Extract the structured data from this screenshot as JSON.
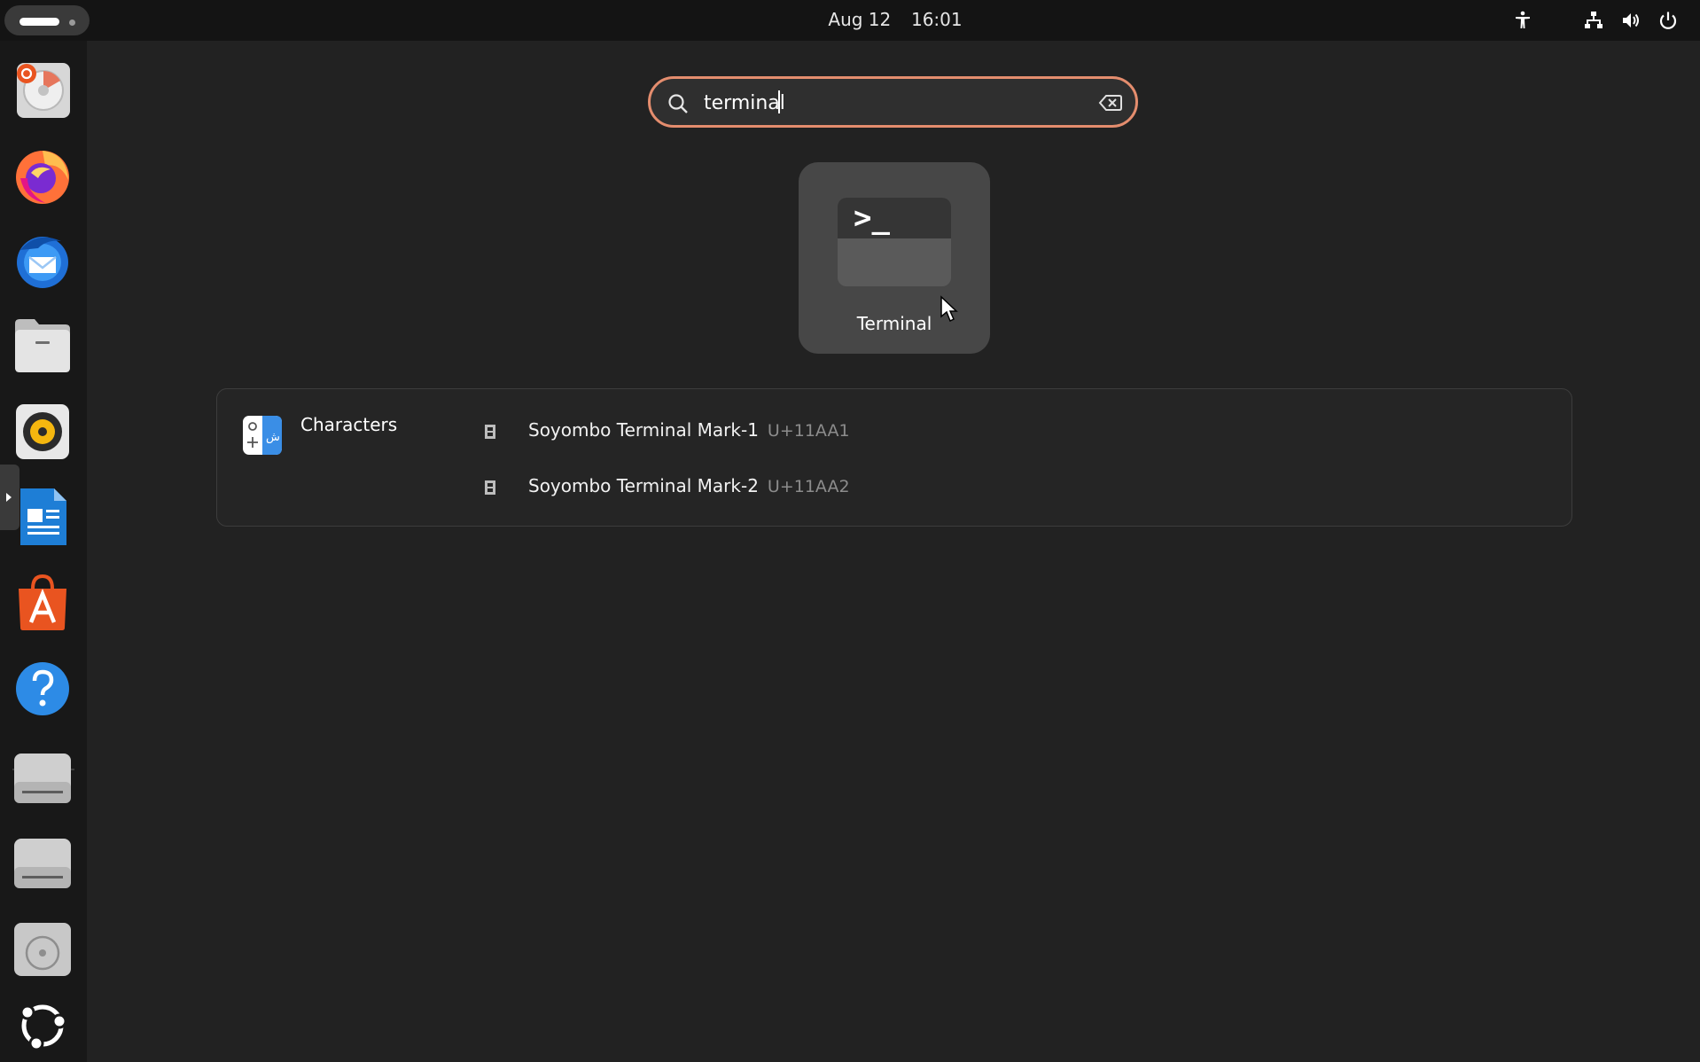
{
  "topbar": {
    "clock_date": "Aug 12",
    "clock_time": "16:01",
    "tray_icons": [
      "accessibility-icon",
      "network-icon",
      "volume-icon",
      "power-icon"
    ]
  },
  "dock": {
    "items": [
      {
        "name": "disk-usage-analyzer-icon"
      },
      {
        "name": "firefox-icon"
      },
      {
        "name": "thunderbird-icon"
      },
      {
        "name": "files-icon"
      },
      {
        "name": "rhythmbox-icon"
      },
      {
        "name": "libreoffice-writer-icon"
      },
      {
        "name": "app-center-icon"
      },
      {
        "name": "help-icon"
      },
      {
        "name": "drive-icon"
      },
      {
        "name": "drive-icon"
      },
      {
        "name": "optical-drive-icon"
      },
      {
        "name": "show-apps-icon"
      }
    ]
  },
  "search": {
    "value": "terminal",
    "border_color": "#e48d6e"
  },
  "app_results": [
    {
      "label": "Terminal",
      "icon": "terminal-icon",
      "prompt": ">_"
    }
  ],
  "provider": {
    "name": "Characters",
    "icon": "characters-app-icon",
    "results": [
      {
        "name": "Soyombo Terminal Mark-1",
        "code": "U+11AA1"
      },
      {
        "name": "Soyombo Terminal Mark-2",
        "code": "U+11AA2"
      }
    ]
  },
  "colors": {
    "background": "#222222",
    "topbar": "#141414",
    "dock": "#181818",
    "accent": "#e48d6e"
  }
}
